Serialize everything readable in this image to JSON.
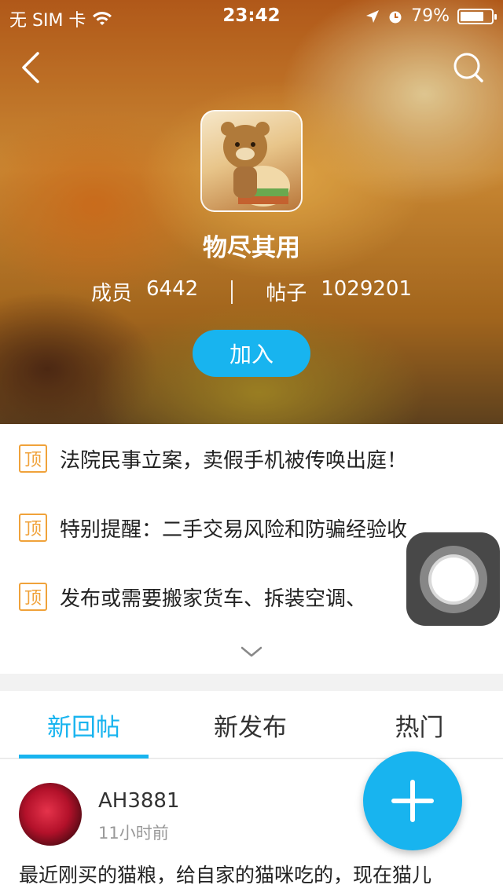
{
  "status_bar": {
    "carrier": "无 SIM 卡",
    "time": "23:42",
    "battery": "79%",
    "battery_level": 0.79,
    "icons": [
      "wifi-icon",
      "location-arrow-icon",
      "alarm-icon",
      "battery-icon"
    ]
  },
  "nav": {
    "back_icon": "chevron-left-icon",
    "search_icon": "search-icon"
  },
  "group": {
    "name": "物尽其用",
    "members_label": "成员",
    "members_count": "6442",
    "posts_label": "帖子",
    "posts_count": "1029201",
    "join_label": "加入"
  },
  "pinned": {
    "badge": "顶",
    "items": [
      {
        "title": "法院民事立案，卖假手机被传唤出庭！"
      },
      {
        "title": "特别提醒：二手交易风险和防骗经验收"
      },
      {
        "title": "发布或需要搬家货车、拆装空调、"
      }
    ],
    "expand_icon": "chevron-down-icon"
  },
  "tabs": [
    {
      "label": "新回帖",
      "active": true
    },
    {
      "label": "新发布",
      "active": false
    },
    {
      "label": "热门",
      "active": false
    }
  ],
  "feed": {
    "posts": [
      {
        "user": "AH3881",
        "time": "11小时前",
        "text": "最近刚买的猫粮，给自家的猫咪吃的，现在猫儿"
      }
    ]
  },
  "fab": {
    "icon": "plus-icon"
  },
  "colors": {
    "accent": "#18b4ef",
    "pin": "#f0a23a"
  }
}
